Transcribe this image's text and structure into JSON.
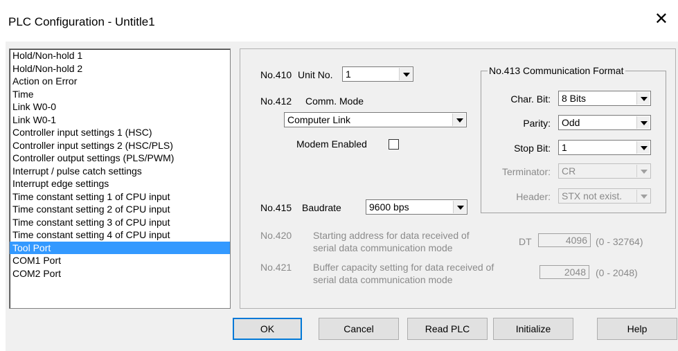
{
  "window": {
    "title": "PLC Configuration - Untitle1",
    "close_glyph": "✕"
  },
  "list": {
    "items": [
      "Hold/Non-hold 1",
      "Hold/Non-hold 2",
      "Action on Error",
      "Time",
      "Link W0-0",
      "Link W0-1",
      "Controller input settings 1 (HSC)",
      "Controller input settings 2 (HSC/PLS)",
      "Controller output settings (PLS/PWM)",
      "Interrupt / pulse catch settings",
      "Interrupt edge settings",
      "Time constant setting 1 of CPU input",
      "Time constant setting 2 of CPU input",
      "Time constant setting 3 of CPU input",
      "Time constant setting 4 of CPU input",
      "Tool Port",
      "COM1 Port",
      "COM2 Port"
    ],
    "selected_index": 15
  },
  "panel": {
    "no410": "No.410",
    "unit_no_label": "Unit No.",
    "unit_no_value": "1",
    "no412": "No.412",
    "comm_mode_label": "Comm. Mode",
    "comm_mode_value": "Computer Link",
    "modem_label": "Modem Enabled",
    "modem_checked": false,
    "no415": "No.415",
    "baudrate_label": "Baudrate",
    "baudrate_value": "9600 bps",
    "no420": "No.420",
    "no420_desc_1": "Starting address for data received of",
    "no420_desc_2": "serial data communication mode",
    "dt_label": "DT",
    "dt_value": "4096",
    "dt_range": "(0 - 32764)",
    "no421": "No.421",
    "no421_desc_1": "Buffer capacity setting for data received of",
    "no421_desc_2": "serial data communication mode",
    "buf_value": "2048",
    "buf_range": "(0 - 2048)",
    "format": {
      "title": "No.413 Communication Format",
      "char_bit_label": "Char. Bit:",
      "char_bit_value": "8 Bits",
      "parity_label": "Parity:",
      "parity_value": "Odd",
      "stop_bit_label": "Stop Bit:",
      "stop_bit_value": "1",
      "terminator_label": "Terminator:",
      "terminator_value": "CR",
      "header_label": "Header:",
      "header_value": "STX not exist."
    }
  },
  "buttons": {
    "ok": "OK",
    "cancel": "Cancel",
    "read_plc": "Read PLC",
    "initialize": "Initialize",
    "help": "Help"
  }
}
